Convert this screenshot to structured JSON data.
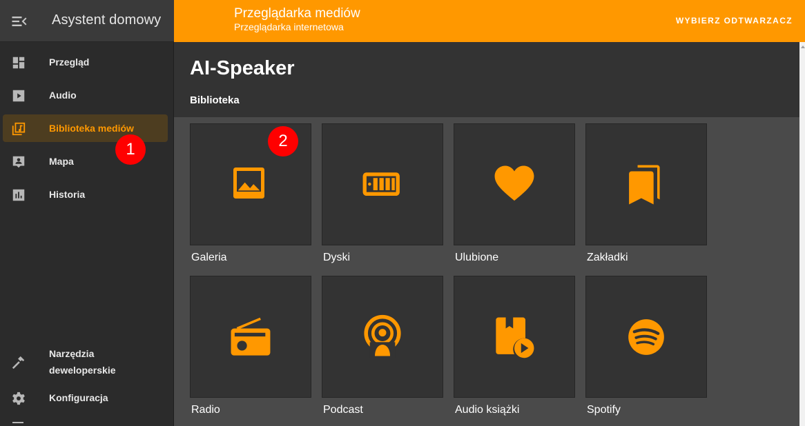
{
  "sidebar": {
    "app_title": "Asystent domowy",
    "items": [
      {
        "label": "Przegląd",
        "icon": "dashboard-icon"
      },
      {
        "label": "Audio",
        "icon": "play-box-icon"
      },
      {
        "label": "Biblioteka mediów",
        "icon": "media-library-icon",
        "active": true
      },
      {
        "label": "Mapa",
        "icon": "map-account-icon"
      },
      {
        "label": "Historia",
        "icon": "chart-box-icon"
      }
    ],
    "developer_tools": {
      "line1": "Narzędzia",
      "line2": "deweloperskie"
    },
    "config": {
      "label": "Konfiguracja"
    }
  },
  "topbar": {
    "title": "Przeglądarka mediów",
    "subtitle": "Przeglądarka internetowa",
    "select_player": "WYBIERZ ODTWARZACZ"
  },
  "content": {
    "title": "AI-Speaker",
    "breadcrumb": "Biblioteka"
  },
  "tiles": [
    {
      "label": "Galeria",
      "icon": "image-icon"
    },
    {
      "label": "Dyski",
      "icon": "nas-drive-icon"
    },
    {
      "label": "Ulubione",
      "icon": "heart-icon"
    },
    {
      "label": "Zakładki",
      "icon": "bookmarks-icon"
    },
    {
      "label": "Radio",
      "icon": "radio-icon"
    },
    {
      "label": "Podcast",
      "icon": "podcast-icon"
    },
    {
      "label": "Audio książki",
      "icon": "audiobook-icon"
    },
    {
      "label": "Spotify",
      "icon": "spotify-icon"
    }
  ],
  "annotations": {
    "badge1": "1",
    "badge2": "2"
  },
  "colors": {
    "accent": "#ff9800",
    "sidebar_bg": "#2b2b2b",
    "tile_bg": "#333333",
    "badge": "#ff0000"
  }
}
